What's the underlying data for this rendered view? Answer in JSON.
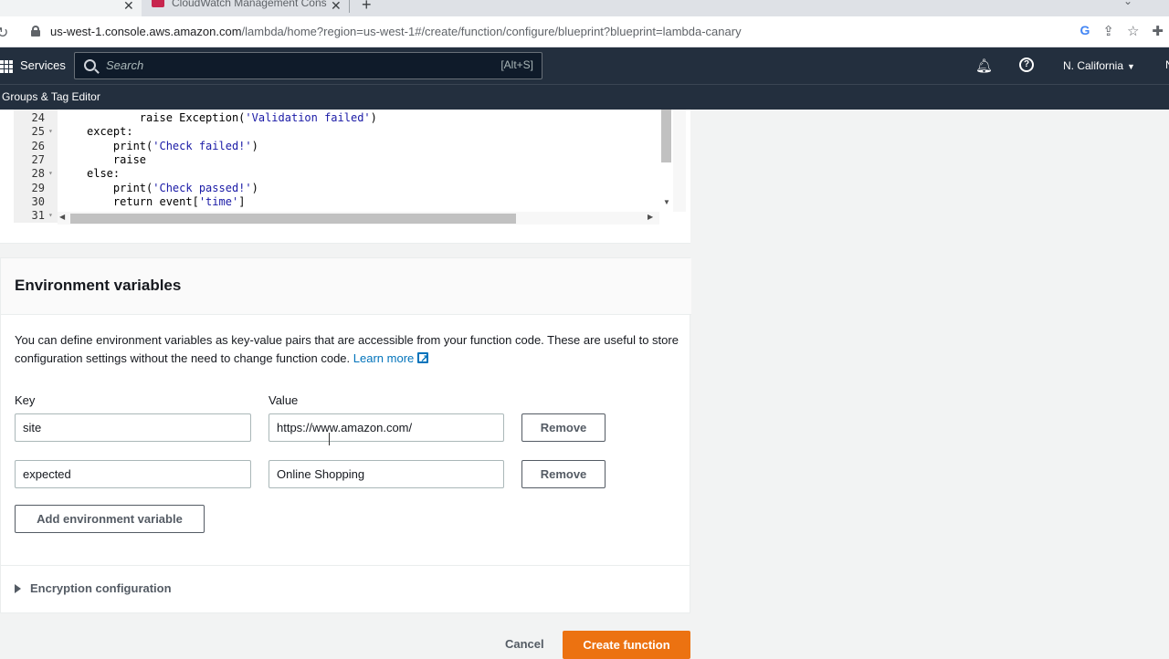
{
  "browser": {
    "tabs": [
      {
        "title": ""
      },
      {
        "title": "CloudWatch Management Conso"
      }
    ],
    "url_host": "us-west-1.console.aws.amazon.com",
    "url_path": "/lambda/home?region=us-west-1#/create/function/configure/blueprint?blueprint=lambda-canary"
  },
  "aws_nav": {
    "services_label": "Services",
    "search_placeholder": "Search",
    "search_shortcut": "[Alt+S]",
    "region_label": "N. California",
    "edge_label": "N"
  },
  "subnav": {
    "item": "e Groups & Tag Editor"
  },
  "code_editor": {
    "lines": [
      {
        "num": "24",
        "fold": "",
        "indent": "        ",
        "text": "raise Exception('Validation failed')"
      },
      {
        "num": "25",
        "fold": "▾",
        "indent": "",
        "text": "except:"
      },
      {
        "num": "26",
        "fold": "",
        "indent": "    ",
        "text": "print('Check failed!')"
      },
      {
        "num": "27",
        "fold": "",
        "indent": "    ",
        "text": "raise"
      },
      {
        "num": "28",
        "fold": "▾",
        "indent": "",
        "text": "else:"
      },
      {
        "num": "29",
        "fold": "",
        "indent": "    ",
        "text": "print('Check passed!')"
      },
      {
        "num": "30",
        "fold": "",
        "indent": "    ",
        "text": "return event['time']"
      },
      {
        "num": "31",
        "fold": "▾",
        "indent": "",
        "text": ""
      }
    ]
  },
  "env": {
    "title": "Environment variables",
    "description": "You can define environment variables as key-value pairs that are accessible from your function code. These are useful to store configuration settings without the need to change function code.",
    "learn_more": "Learn more",
    "key_label": "Key",
    "value_label": "Value",
    "rows": [
      {
        "key": "site",
        "value": "https://www.amazon.com/",
        "remove": "Remove"
      },
      {
        "key": "expected",
        "value": "Online Shopping",
        "remove": "Remove"
      }
    ],
    "add_label": "Add environment variable",
    "encryption_label": "Encryption configuration"
  },
  "footer": {
    "cancel_label": "Cancel",
    "create_label": "Create function"
  },
  "colors": {
    "primary_button": "#ec7211",
    "link": "#0073bb",
    "nav_bg": "#232f3e"
  }
}
